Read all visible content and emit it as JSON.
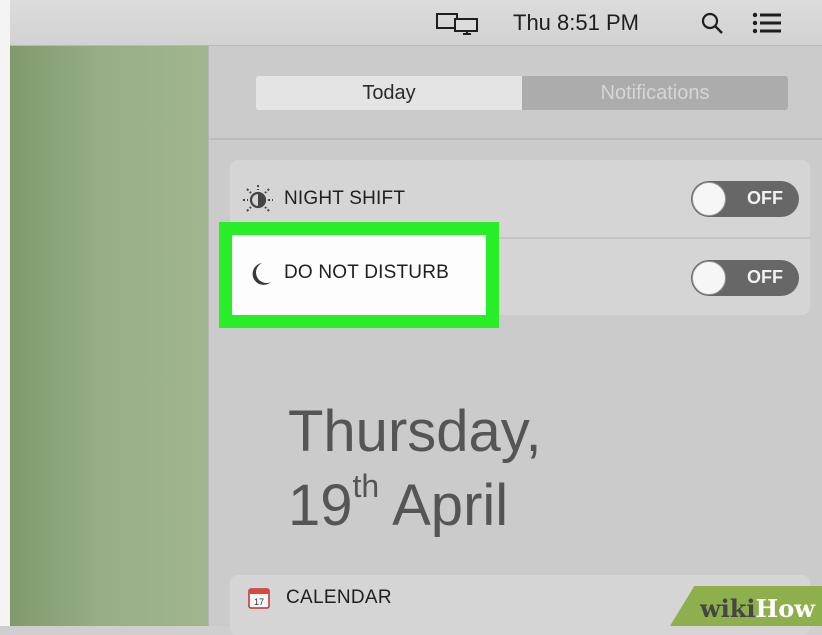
{
  "menubar": {
    "clock": "Thu 8:51 PM",
    "icons": [
      "display-mirroring-icon",
      "spotlight-search-icon",
      "notification-center-icon"
    ]
  },
  "tabs": {
    "today": "Today",
    "notifications": "Notifications"
  },
  "toggles": [
    {
      "label": "NIGHT SHIFT",
      "state": "OFF",
      "icon": "night-shift-icon"
    },
    {
      "label": "DO NOT DISTURB",
      "state": "OFF",
      "icon": "moon-icon"
    }
  ],
  "date": {
    "weekday": "Thursday,",
    "day": "19",
    "suffix": "th",
    "month": "April"
  },
  "calendar": {
    "label": "CALENDAR"
  },
  "watermark": {
    "wiki": "wiki",
    "how": "How"
  },
  "colors": {
    "highlight": "#27ee27",
    "desktop": "#97ad84",
    "switch_off": "#676767"
  }
}
